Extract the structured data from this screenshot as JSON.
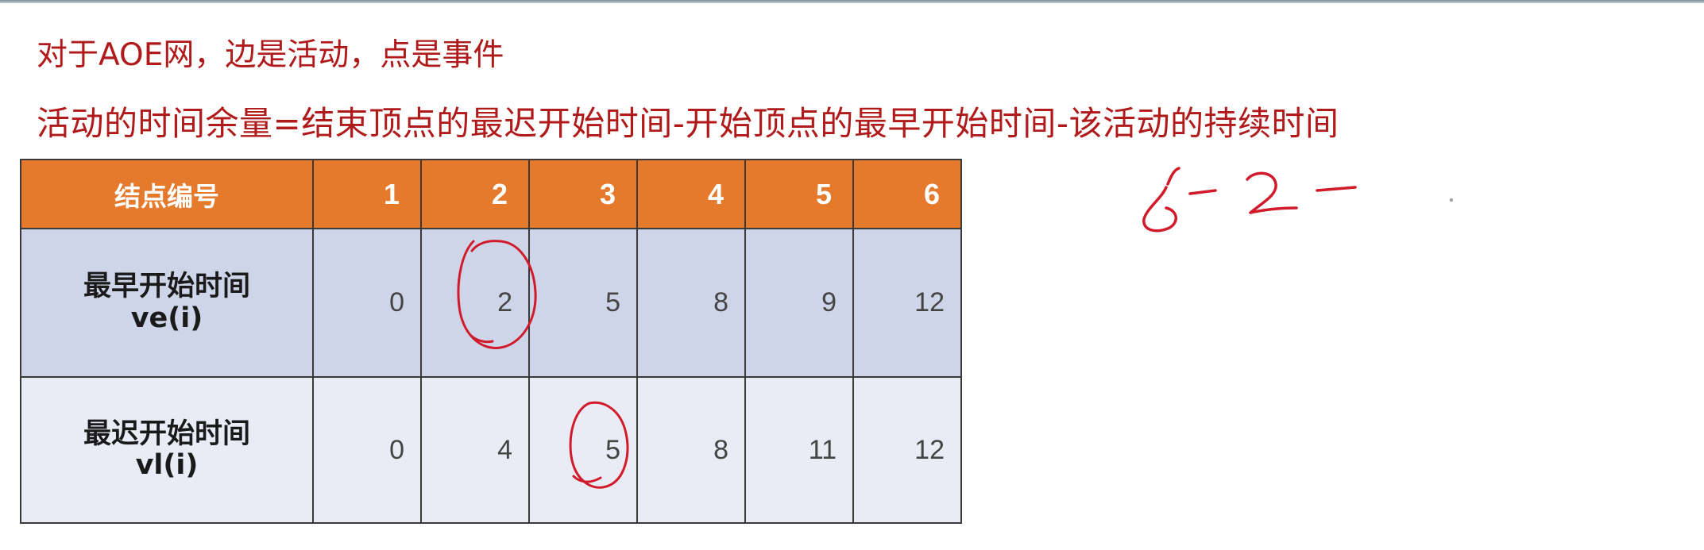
{
  "notes": {
    "line1": "对于AOE网，边是活动，点是事件",
    "line2": "活动的时间余量=结束顶点的最迟开始时间-开始顶点的最早开始时间-该活动的持续时间"
  },
  "table": {
    "header_label": "结点编号",
    "node_ids": [
      "1",
      "2",
      "3",
      "4",
      "5",
      "6"
    ],
    "rows": [
      {
        "label_line1": "最早开始时间",
        "label_line2": "ve(i)",
        "values": [
          "0",
          "2",
          "5",
          "8",
          "9",
          "12"
        ]
      },
      {
        "label_line1": "最迟开始时间",
        "label_line2": "vl(i)",
        "values": [
          "0",
          "4",
          "5",
          "8",
          "11",
          "12"
        ]
      }
    ]
  },
  "annotations": {
    "ink_color": "#d11a2a",
    "circled_cells": [
      "ve(2)",
      "vl(3)"
    ]
  },
  "colors": {
    "header_bg": "#e57a2c",
    "row_early_bg": "#cfd5e8",
    "row_late_bg": "#e9ecf5",
    "text_red": "#b01a1a"
  }
}
